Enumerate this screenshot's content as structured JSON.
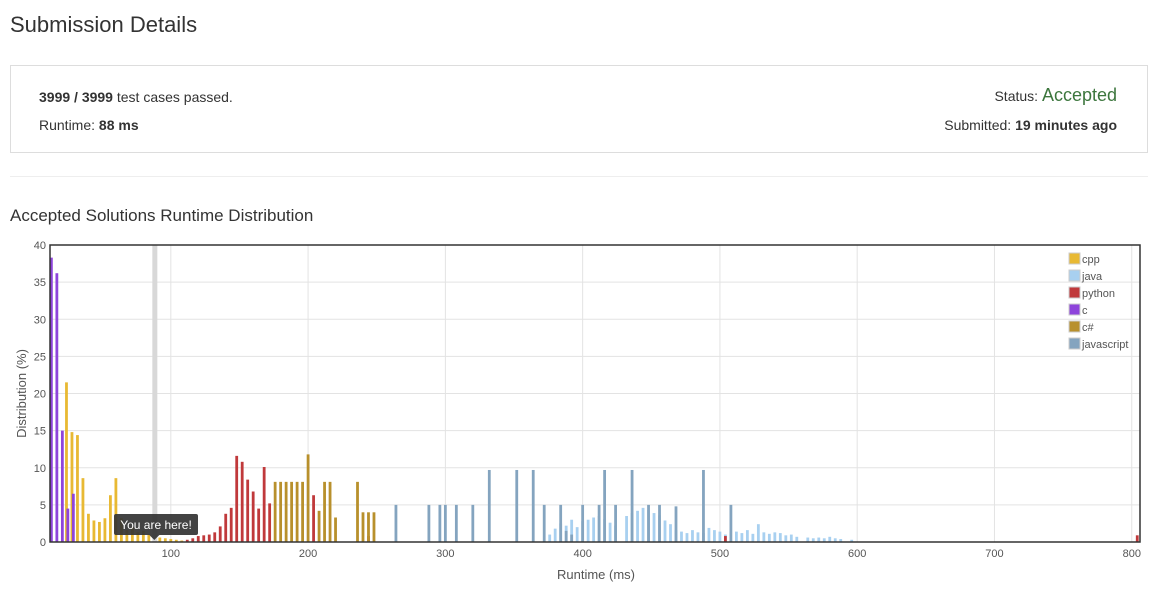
{
  "page": {
    "title": "Submission Details"
  },
  "details": {
    "cases_passed": "3999",
    "cases_sep": " / ",
    "cases_total": "3999",
    "cases_suffix": " test cases passed.",
    "runtime_label": "Runtime: ",
    "runtime_value": "88 ms",
    "status_label": "Status: ",
    "status_value": "Accepted",
    "submitted_label": "Submitted: ",
    "submitted_value": "19 minutes ago"
  },
  "colors": {
    "cpp": "#e8b933",
    "java": "#a8d0f0",
    "python": "#c0393b",
    "c": "#8e44db",
    "csharp": "#b8902c",
    "javascript": "#84a4bf",
    "status_accepted": "#3c763d",
    "marker": "#d8d8d8",
    "tooltip": "#333333"
  },
  "chart_data": {
    "type": "bar",
    "title": "Accepted Solutions Runtime Distribution",
    "xlabel": "Runtime (ms)",
    "ylabel": "Distribution (%)",
    "xlim": [
      12,
      806
    ],
    "ylim": [
      0,
      40
    ],
    "xticks": [
      100,
      200,
      300,
      400,
      500,
      600,
      700,
      800
    ],
    "yticks": [
      0,
      5,
      10,
      15,
      20,
      25,
      30,
      35,
      40
    ],
    "grid": true,
    "legend": "top-right",
    "marker_x": 88,
    "marker_label": "You are here!",
    "series": [
      {
        "name": "cpp",
        "color": "#e8b933",
        "points": [
          [
            24,
            21.5
          ],
          [
            28,
            14.8
          ],
          [
            32,
            14.4
          ],
          [
            36,
            8.6
          ],
          [
            40,
            3.8
          ],
          [
            44,
            2.9
          ],
          [
            48,
            2.7
          ],
          [
            52,
            3.2
          ],
          [
            56,
            6.3
          ],
          [
            60,
            8.6
          ],
          [
            64,
            3.2
          ],
          [
            68,
            1.6
          ],
          [
            72,
            2.0
          ],
          [
            76,
            1.3
          ],
          [
            80,
            1.5
          ],
          [
            84,
            1.0
          ],
          [
            92,
            0.6
          ],
          [
            96,
            0.5
          ],
          [
            100,
            0.4
          ],
          [
            104,
            0.3
          ],
          [
            108,
            0.2
          ]
        ]
      },
      {
        "name": "java",
        "color": "#a8d0f0",
        "points": [
          [
            376,
            1.0
          ],
          [
            380,
            1.8
          ],
          [
            384,
            2.5
          ],
          [
            388,
            2.2
          ],
          [
            392,
            3.0
          ],
          [
            396,
            2.0
          ],
          [
            400,
            2.8
          ],
          [
            404,
            3.0
          ],
          [
            408,
            3.3
          ],
          [
            412,
            3.5
          ],
          [
            416,
            3.1
          ],
          [
            420,
            2.6
          ],
          [
            424,
            2.2
          ],
          [
            432,
            3.5
          ],
          [
            436,
            3.9
          ],
          [
            440,
            4.2
          ],
          [
            444,
            4.6
          ],
          [
            448,
            4.3
          ],
          [
            452,
            3.9
          ],
          [
            456,
            3.6
          ],
          [
            460,
            2.9
          ],
          [
            464,
            2.4
          ],
          [
            468,
            1.6
          ],
          [
            472,
            1.4
          ],
          [
            476,
            1.2
          ],
          [
            480,
            1.6
          ],
          [
            484,
            1.3
          ],
          [
            488,
            1.2
          ],
          [
            492,
            1.9
          ],
          [
            496,
            1.6
          ],
          [
            500,
            1.4
          ],
          [
            504,
            1.0
          ],
          [
            512,
            1.4
          ],
          [
            516,
            1.2
          ],
          [
            520,
            1.6
          ],
          [
            524,
            1.1
          ],
          [
            528,
            2.4
          ],
          [
            532,
            1.3
          ],
          [
            536,
            1.1
          ],
          [
            540,
            1.3
          ],
          [
            544,
            1.2
          ],
          [
            548,
            0.9
          ],
          [
            552,
            1.0
          ],
          [
            556,
            0.7
          ],
          [
            564,
            0.6
          ],
          [
            568,
            0.5
          ],
          [
            572,
            0.6
          ],
          [
            576,
            0.5
          ],
          [
            580,
            0.7
          ],
          [
            584,
            0.5
          ],
          [
            588,
            0.4
          ],
          [
            596,
            0.3
          ]
        ]
      },
      {
        "name": "python",
        "color": "#c0393b",
        "points": [
          [
            112,
            0.3
          ],
          [
            116,
            0.5
          ],
          [
            120,
            0.8
          ],
          [
            124,
            0.9
          ],
          [
            128,
            1.0
          ],
          [
            132,
            1.3
          ],
          [
            136,
            2.1
          ],
          [
            140,
            3.8
          ],
          [
            144,
            4.6
          ],
          [
            148,
            11.6
          ],
          [
            152,
            10.8
          ],
          [
            156,
            8.4
          ],
          [
            160,
            6.8
          ],
          [
            164,
            4.5
          ],
          [
            168,
            10.1
          ],
          [
            172,
            5.2
          ],
          [
            204,
            6.3
          ],
          [
            244,
            0.8
          ],
          [
            504,
            0.8
          ],
          [
            804,
            0.9
          ]
        ]
      },
      {
        "name": "c",
        "color": "#8e44db",
        "points": [
          [
            13,
            38.3
          ],
          [
            17,
            36.2
          ],
          [
            21,
            15.0
          ],
          [
            25,
            4.5
          ],
          [
            29,
            6.5
          ]
        ]
      },
      {
        "name": "c#",
        "color": "#b8902c",
        "points": [
          [
            176,
            8.1
          ],
          [
            180,
            8.1
          ],
          [
            184,
            8.1
          ],
          [
            188,
            8.1
          ],
          [
            192,
            8.1
          ],
          [
            196,
            8.1
          ],
          [
            200,
            11.8
          ],
          [
            208,
            4.2
          ],
          [
            212,
            8.1
          ],
          [
            216,
            8.1
          ],
          [
            220,
            3.3
          ],
          [
            236,
            8.1
          ],
          [
            240,
            4.0
          ],
          [
            244,
            4.0
          ],
          [
            248,
            4.0
          ]
        ]
      },
      {
        "name": "javascript",
        "color": "#84a4bf",
        "points": [
          [
            264,
            5.0
          ],
          [
            288,
            5.0
          ],
          [
            296,
            5.0
          ],
          [
            300,
            5.0
          ],
          [
            308,
            5.0
          ],
          [
            320,
            5.0
          ],
          [
            332,
            9.7
          ],
          [
            352,
            9.7
          ],
          [
            364,
            9.7
          ],
          [
            372,
            5.0
          ],
          [
            384,
            5.0
          ],
          [
            388,
            1.5
          ],
          [
            392,
            1.0
          ],
          [
            400,
            5.0
          ],
          [
            412,
            5.0
          ],
          [
            416,
            9.7
          ],
          [
            424,
            5.0
          ],
          [
            436,
            9.7
          ],
          [
            448,
            5.0
          ],
          [
            456,
            5.0
          ],
          [
            468,
            4.8
          ],
          [
            488,
            9.7
          ],
          [
            508,
            5.0
          ]
        ]
      }
    ]
  }
}
